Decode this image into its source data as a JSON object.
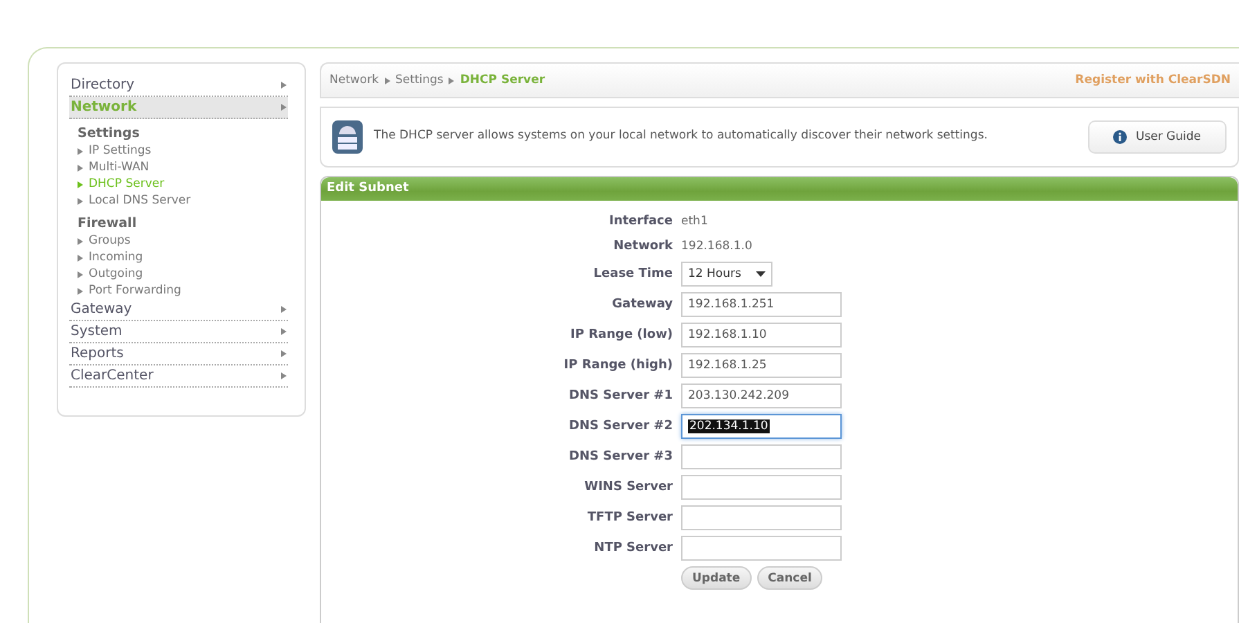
{
  "sidebar": {
    "sections": [
      {
        "label": "Directory",
        "selected": false
      },
      {
        "label": "Network",
        "selected": true,
        "groups": [
          {
            "label": "Settings",
            "items": [
              {
                "label": "IP Settings",
                "selected": false
              },
              {
                "label": "Multi-WAN",
                "selected": false
              },
              {
                "label": "DHCP Server",
                "selected": true
              },
              {
                "label": "Local DNS Server",
                "selected": false
              }
            ]
          },
          {
            "label": "Firewall",
            "items": [
              {
                "label": "Groups",
                "selected": false
              },
              {
                "label": "Incoming",
                "selected": false
              },
              {
                "label": "Outgoing",
                "selected": false
              },
              {
                "label": "Port Forwarding",
                "selected": false
              }
            ]
          }
        ]
      },
      {
        "label": "Gateway",
        "selected": false
      },
      {
        "label": "System",
        "selected": false
      },
      {
        "label": "Reports",
        "selected": false
      },
      {
        "label": "ClearCenter",
        "selected": false
      }
    ]
  },
  "breadcrumb": [
    {
      "label": "Network",
      "selected": false
    },
    {
      "label": "Settings",
      "selected": false
    },
    {
      "label": "DHCP Server",
      "selected": true
    }
  ],
  "register_link": "Register with ClearSDN",
  "help": {
    "text": "The DHCP server allows systems on your local network to automatically discover their network settings.",
    "button": "User Guide"
  },
  "form": {
    "title": "Edit Subnet",
    "fields": [
      {
        "kind": "text",
        "label": "Interface",
        "value": "eth1"
      },
      {
        "kind": "text",
        "label": "Network",
        "value": "192.168.1.0"
      },
      {
        "kind": "select",
        "label": "Lease Time",
        "value": "12 Hours"
      },
      {
        "kind": "input",
        "label": "Gateway",
        "value": "192.168.1.251",
        "highlighted": false
      },
      {
        "kind": "input",
        "label": "IP Range (low)",
        "value": "192.168.1.10",
        "highlighted": false
      },
      {
        "kind": "input",
        "label": "IP Range (high)",
        "value": "192.168.1.25",
        "highlighted": false
      },
      {
        "kind": "input",
        "label": "DNS Server #1",
        "value": "203.130.242.209",
        "highlighted": false
      },
      {
        "kind": "input",
        "label": "DNS Server #2",
        "value": "202.134.1.10",
        "highlighted": true
      },
      {
        "kind": "input",
        "label": "DNS Server #3",
        "highlighted": false
      },
      {
        "kind": "input",
        "label": "WINS Server",
        "highlighted": false
      },
      {
        "kind": "input",
        "label": "TFTP Server",
        "highlighted": false
      },
      {
        "kind": "input",
        "label": "NTP Server",
        "highlighted": false
      }
    ],
    "buttons": [
      "Update",
      "Cancel"
    ]
  }
}
